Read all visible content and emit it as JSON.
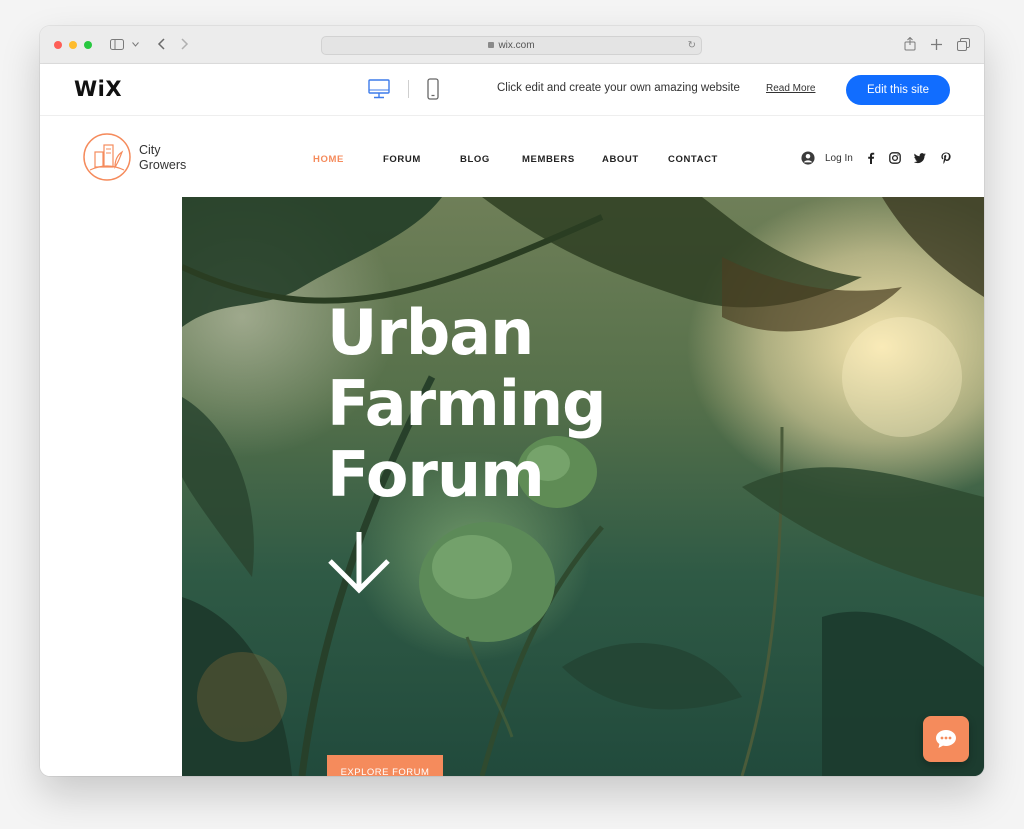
{
  "browser": {
    "url": "wix.com",
    "icons": [
      "sidebar-icon",
      "chevron-down-icon",
      "back-icon",
      "forward-icon",
      "lock-icon",
      "reload-icon",
      "share-icon",
      "new-tab-icon",
      "tabs-icon"
    ]
  },
  "wix_banner": {
    "logo": "WiX",
    "message": "Click edit and create your own amazing website",
    "read_more": "Read More",
    "edit_button": "Edit this site",
    "accent_color": "#116dff"
  },
  "site": {
    "brand": {
      "line1": "City",
      "line2": "Growers"
    },
    "nav": [
      {
        "label": "HOME",
        "active": true
      },
      {
        "label": "FORUM",
        "active": false
      },
      {
        "label": "BLOG",
        "active": false
      },
      {
        "label": "MEMBERS",
        "active": false
      },
      {
        "label": "ABOUT",
        "active": false
      },
      {
        "label": "CONTACT",
        "active": false
      }
    ],
    "login_label": "Log In",
    "social_icons": [
      "facebook-icon",
      "instagram-icon",
      "twitter-icon",
      "pinterest-icon"
    ],
    "accent_color": "#f58b5c"
  },
  "hero": {
    "title_lines": [
      "Urban",
      "Farming",
      "Forum"
    ],
    "cta": "EXPLORE FORUM"
  }
}
